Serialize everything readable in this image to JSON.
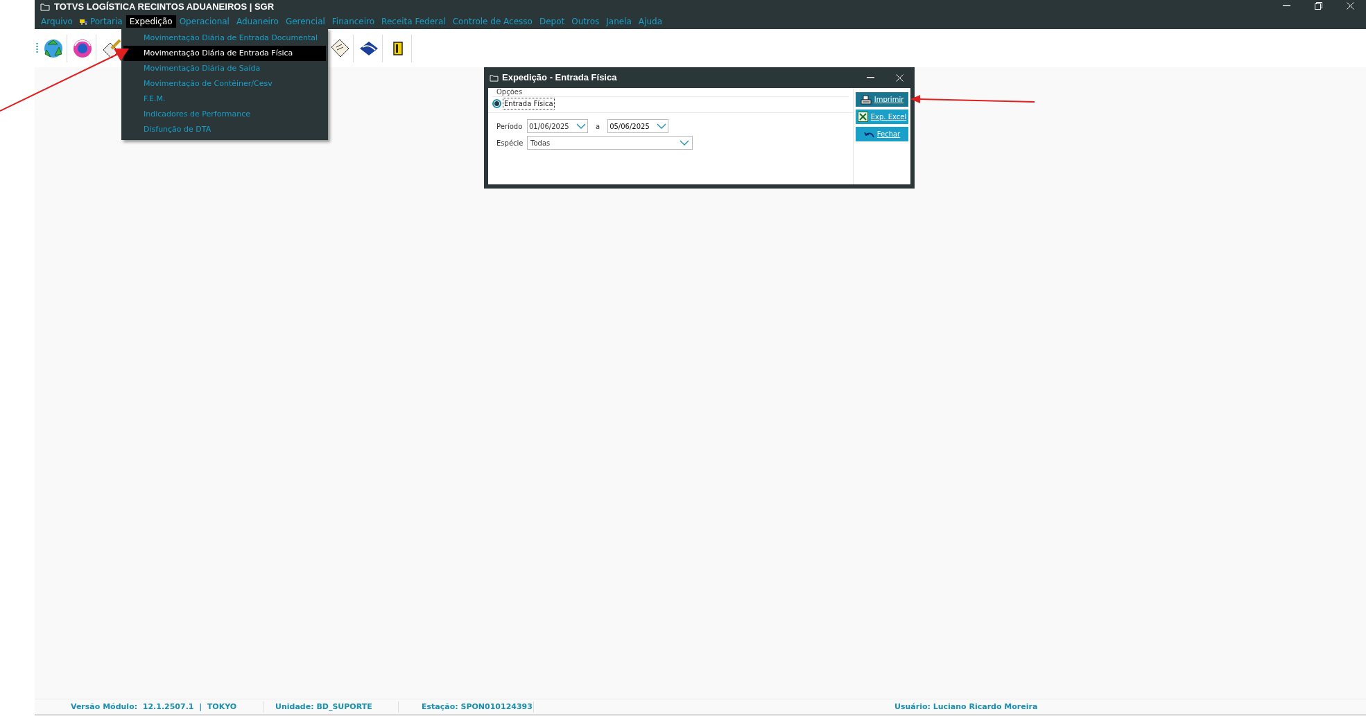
{
  "window": {
    "title": "TOTVS LOGÍSTICA RECINTOS ADUANEIROS | SGR"
  },
  "menu": [
    {
      "label": "Arquivo",
      "selected": false,
      "kind": "text"
    },
    {
      "label": "Portaria",
      "selected": false,
      "kind": "icon"
    },
    {
      "label": "Expedição",
      "selected": true,
      "kind": "text"
    },
    {
      "label": "Operacional",
      "selected": false,
      "kind": "text"
    },
    {
      "label": "Aduaneiro",
      "selected": false,
      "kind": "text"
    },
    {
      "label": "Gerencial",
      "selected": false,
      "kind": "text"
    },
    {
      "label": "Financeiro",
      "selected": false,
      "kind": "text"
    },
    {
      "label": "Receita Federal",
      "selected": false,
      "kind": "text"
    },
    {
      "label": "Controle de Acesso",
      "selected": false,
      "kind": "text"
    },
    {
      "label": "Depot",
      "selected": false,
      "kind": "text"
    },
    {
      "label": "Outros",
      "selected": false,
      "kind": "text"
    },
    {
      "label": "Janela",
      "selected": false,
      "kind": "text"
    },
    {
      "label": "Ajuda",
      "selected": false,
      "kind": "text"
    }
  ],
  "dropdown": [
    {
      "label": "Movimentação Diária de Entrada Documental",
      "selected": false
    },
    {
      "label": "Movimentação Diária de Entrada Física",
      "selected": true
    },
    {
      "label": "Movimentação Diária de Saída",
      "selected": false
    },
    {
      "label": "Movimentação de Contêiner/Cesv",
      "selected": false
    },
    {
      "label": "F.E.M.",
      "selected": false
    },
    {
      "label": "Indicadores de Performance",
      "selected": false
    },
    {
      "label": "Disfunção de DTA",
      "selected": false
    }
  ],
  "dialog": {
    "title": "Expedição - Entrada Física",
    "group_label": "Opções",
    "radio": {
      "label": "Entrada Física",
      "selected": true
    },
    "period_label": "Período",
    "date_from": "01/06/2025",
    "separator": "a",
    "date_to": "05/06/2025",
    "species_label": "Espécie",
    "species_value": "Todas",
    "buttons": [
      {
        "label": "Imprimir",
        "kind": "print",
        "selected": true
      },
      {
        "label": "Exp. Excel",
        "kind": "excel",
        "selected": false
      },
      {
        "label": "Fechar",
        "kind": "close",
        "selected": false
      }
    ]
  },
  "status_bar": [
    {
      "text": "Versão Módulo:  12.1.2507.1  |  TOKYO"
    },
    {
      "text": "Unidade: BD_SUPORTE"
    },
    {
      "text": "Estação: SPON010124393"
    },
    {
      "text": "Usuário: Luciano Ricardo Moreira"
    }
  ]
}
